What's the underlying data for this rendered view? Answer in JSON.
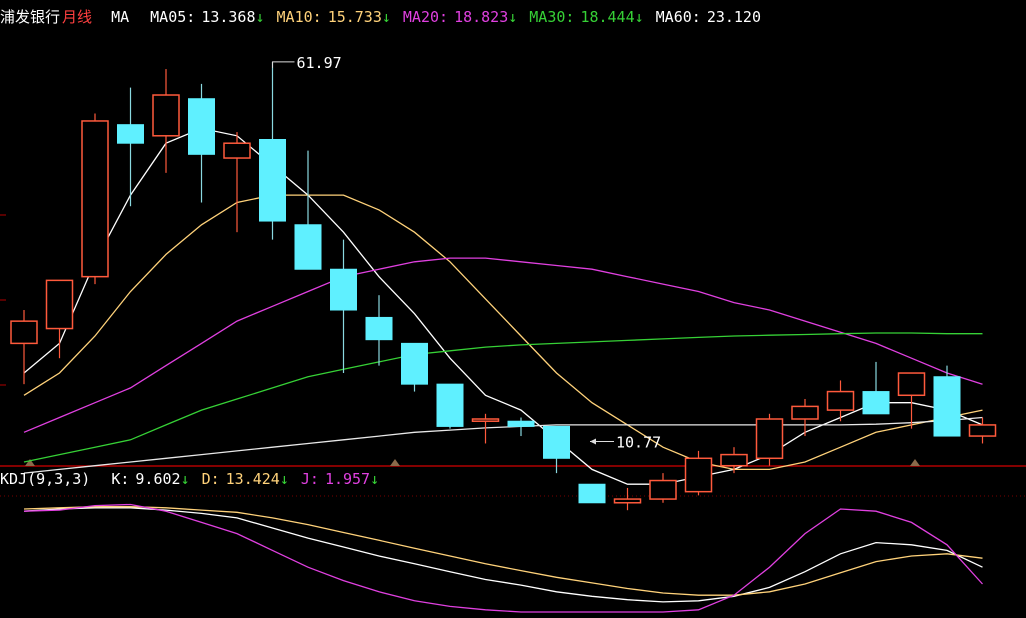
{
  "header": {
    "stock_name": "浦发银行",
    "period": "月线",
    "ma_label": "MA",
    "ma_items": [
      {
        "label": "MA05:",
        "value": "13.368",
        "arrow": "↓",
        "color": "#ffffff"
      },
      {
        "label": "MA10:",
        "value": "15.733",
        "arrow": "↓",
        "color": "#ffd27a"
      },
      {
        "label": "MA20:",
        "value": "18.823",
        "arrow": "↓",
        "color": "#e040e0"
      },
      {
        "label": "MA30:",
        "value": "18.444",
        "arrow": "↓",
        "color": "#36d136"
      },
      {
        "label": "MA60:",
        "value": "23.120",
        "arrow": "",
        "color": "#ffffff"
      }
    ]
  },
  "kdj_header": {
    "label": "KDJ(9,3,3)",
    "items": [
      {
        "label": "K:",
        "value": "9.602",
        "arrow": "↓",
        "color": "#ffffff"
      },
      {
        "label": "D:",
        "value": "13.424",
        "arrow": "↓",
        "color": "#ffd27a"
      },
      {
        "label": "J:",
        "value": "1.957",
        "arrow": "↓",
        "color": "#e040e0"
      }
    ]
  },
  "chart_data": {
    "type": "candlestick",
    "price_range": [
      8,
      66
    ],
    "annotations": [
      {
        "text": "61.97",
        "candle_index": 7,
        "price": 61.97,
        "kind": "high"
      },
      {
        "text": "10.77",
        "candle_index": 16,
        "price": 10.77,
        "kind": "low"
      }
    ],
    "candles": [
      {
        "o": 24.0,
        "h": 28.5,
        "l": 18.5,
        "c": 27.0
      },
      {
        "o": 26.0,
        "h": 32.0,
        "l": 22.0,
        "c": 32.5
      },
      {
        "o": 33.0,
        "h": 55.0,
        "l": 32.0,
        "c": 54.0
      },
      {
        "o": 53.5,
        "h": 58.5,
        "l": 42.5,
        "c": 51.0
      },
      {
        "o": 52.0,
        "h": 61.0,
        "l": 47.0,
        "c": 57.5
      },
      {
        "o": 57.0,
        "h": 59.0,
        "l": 43.0,
        "c": 49.5
      },
      {
        "o": 49.0,
        "h": 52.5,
        "l": 39.0,
        "c": 51.0
      },
      {
        "o": 51.5,
        "h": 61.97,
        "l": 38.0,
        "c": 40.5
      },
      {
        "o": 40.0,
        "h": 50.0,
        "l": 35.5,
        "c": 34.0
      },
      {
        "o": 34.0,
        "h": 38.0,
        "l": 20.0,
        "c": 28.5
      },
      {
        "o": 27.5,
        "h": 30.5,
        "l": 21.0,
        "c": 24.5
      },
      {
        "o": 24.0,
        "h": 24.0,
        "l": 17.5,
        "c": 18.5
      },
      {
        "o": 18.5,
        "h": 18.5,
        "l": 12.5,
        "c": 12.8
      },
      {
        "o": 13.5,
        "h": 14.5,
        "l": 10.5,
        "c": 13.8
      },
      {
        "o": 13.5,
        "h": 14.0,
        "l": 11.5,
        "c": 12.8
      },
      {
        "o": 12.8,
        "h": 12.8,
        "l": 6.5,
        "c": 8.5
      },
      {
        "o": 5.0,
        "h": 5.0,
        "l": 2.5,
        "c": 2.5
      },
      {
        "o": 2.5,
        "h": 4.5,
        "l": 1.5,
        "c": 3.0
      },
      {
        "o": 3.0,
        "h": 6.5,
        "l": 2.5,
        "c": 5.5
      },
      {
        "o": 4.0,
        "h": 9.5,
        "l": 3.5,
        "c": 8.5
      },
      {
        "o": 7.5,
        "h": 10.0,
        "l": 6.5,
        "c": 9.0
      },
      {
        "o": 8.5,
        "h": 14.5,
        "l": 7.5,
        "c": 13.8
      },
      {
        "o": 13.8,
        "h": 16.5,
        "l": 11.5,
        "c": 15.5
      },
      {
        "o": 15.0,
        "h": 19.0,
        "l": 13.5,
        "c": 17.5
      },
      {
        "o": 17.5,
        "h": 21.5,
        "l": 16.5,
        "c": 14.5
      },
      {
        "o": 17.0,
        "h": 20.0,
        "l": 12.5,
        "c": 20.0
      },
      {
        "o": 19.5,
        "h": 21.0,
        "l": 16.0,
        "c": 11.5
      },
      {
        "o": 11.5,
        "h": 14.0,
        "l": 10.5,
        "c": 13.0
      }
    ],
    "ma_series": [
      {
        "name": "MA05",
        "color": "#ffffff",
        "values": [
          20,
          24,
          35,
          44,
          51,
          53,
          52,
          48,
          44,
          39,
          33,
          28,
          22,
          17,
          15,
          11,
          7,
          5,
          5,
          6,
          7,
          9,
          12,
          14,
          16,
          16,
          15,
          13
        ]
      },
      {
        "name": "MA10",
        "color": "#ffd27a",
        "values": [
          17,
          20,
          25,
          31,
          36,
          40,
          43,
          44,
          44,
          44,
          42,
          39,
          35,
          30,
          25,
          20,
          16,
          13,
          10,
          8,
          7,
          7,
          8,
          10,
          12,
          13,
          14,
          15
        ]
      },
      {
        "name": "MA20",
        "color": "#e040e0",
        "values": [
          12,
          14,
          16,
          18,
          21,
          24,
          27,
          29,
          31,
          33,
          34,
          35,
          35.5,
          35.5,
          35,
          34.5,
          34,
          33,
          32,
          31,
          29.5,
          28.5,
          27,
          25.5,
          24,
          22,
          20,
          18.5
        ]
      },
      {
        "name": "MA30",
        "color": "#36d136",
        "values": [
          8,
          9,
          10,
          11,
          13,
          15,
          16.5,
          18,
          19.5,
          20.5,
          21.5,
          22.5,
          23,
          23.5,
          23.8,
          24,
          24.2,
          24.4,
          24.6,
          24.8,
          25,
          25.1,
          25.2,
          25.3,
          25.4,
          25.4,
          25.3,
          25.3
        ]
      },
      {
        "name": "MA60",
        "color": "#e8e8e8",
        "values": [
          6.5,
          7,
          7.5,
          8,
          8.5,
          9,
          9.5,
          10,
          10.5,
          11,
          11.5,
          12,
          12.3,
          12.6,
          12.8,
          13,
          13,
          13,
          13,
          13,
          13,
          13,
          13,
          13,
          13.1,
          13.3,
          13.6,
          14
        ]
      }
    ],
    "kdj": {
      "range": [
        0,
        100
      ],
      "series": [
        {
          "name": "K",
          "color": "#ffffff",
          "values": [
            90,
            92,
            93,
            93,
            91,
            88,
            84,
            75,
            66,
            58,
            50,
            43,
            36,
            29,
            24,
            18,
            14,
            11,
            9,
            10,
            14,
            22,
            36,
            52,
            62,
            60,
            55,
            40
          ]
        },
        {
          "name": "D",
          "color": "#ffd27a",
          "values": [
            92,
            93,
            94,
            94,
            93,
            91,
            89,
            84,
            78,
            71,
            64,
            57,
            50,
            43,
            37,
            31,
            26,
            21,
            17,
            15,
            15,
            18,
            25,
            35,
            45,
            50,
            52,
            48
          ]
        },
        {
          "name": "J",
          "color": "#e040e0",
          "values": [
            90,
            91,
            95,
            96,
            90,
            80,
            70,
            55,
            40,
            28,
            18,
            10,
            5,
            2,
            0,
            0,
            0,
            0,
            0,
            2,
            15,
            40,
            70,
            92,
            90,
            80,
            60,
            25
          ]
        }
      ]
    }
  }
}
